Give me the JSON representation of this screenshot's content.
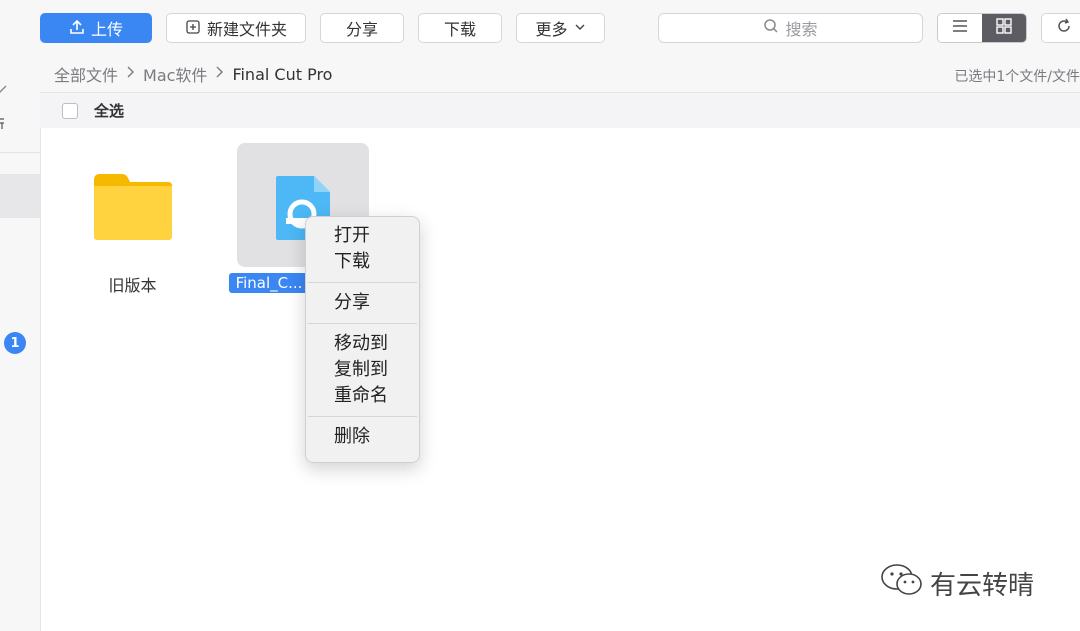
{
  "toolbar": {
    "upload_label": "上传",
    "new_folder_label": "新建文件夹",
    "share_label": "分享",
    "download_label": "下载",
    "more_label": "更多",
    "search_placeholder": "搜索",
    "accent": "#3a86f3"
  },
  "breadcrumb": {
    "items": [
      "全部文件",
      "Mac软件",
      "Final Cut Pro"
    ],
    "selection_status": "已选中1个文件/文件"
  },
  "list_header": {
    "select_all_label": "全选"
  },
  "files": [
    {
      "name": "旧版本",
      "type": "folder",
      "selected": false,
      "icon": "folder-icon"
    },
    {
      "name": "Final_C...",
      "type": "file",
      "selected": true,
      "icon": "app-package-icon"
    }
  ],
  "sidebar": {
    "badge_count": "1"
  },
  "context_menu": {
    "groups": [
      [
        "打开",
        "下载"
      ],
      [
        "分享"
      ],
      [
        "移动到",
        "复制到",
        "重命名"
      ],
      [
        "删除"
      ]
    ]
  },
  "watermark": {
    "text": "有云转晴"
  }
}
